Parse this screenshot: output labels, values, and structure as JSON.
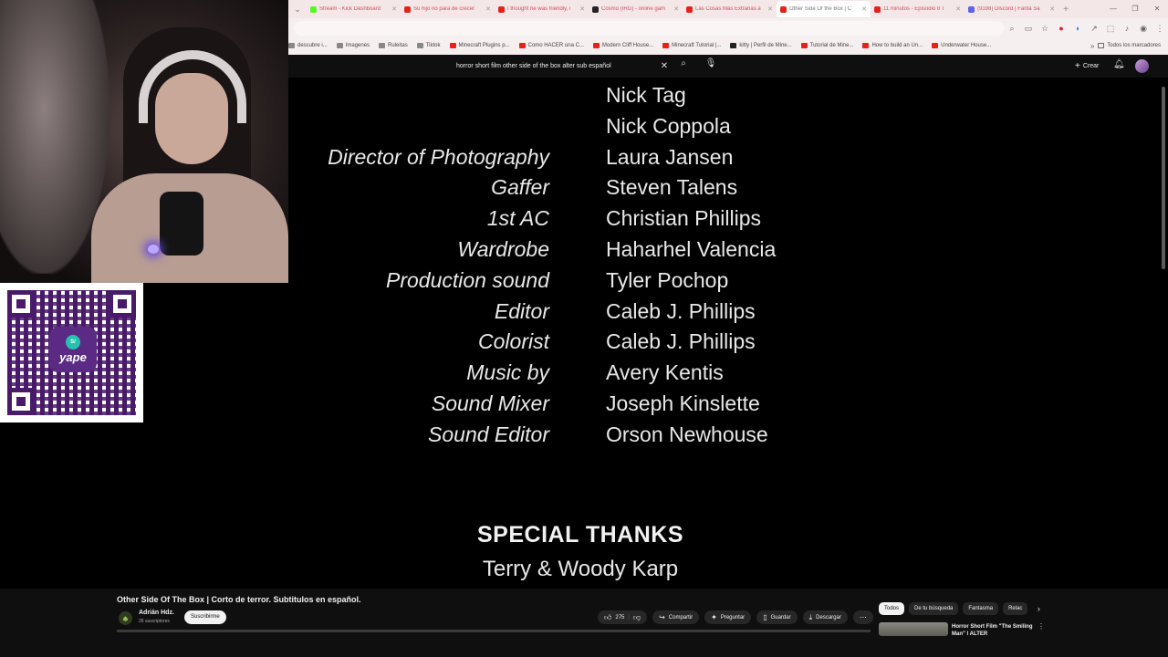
{
  "browser": {
    "tabs": [
      {
        "label": "Stream - Kick Dashboard",
        "color": "#53fc18",
        "active": false
      },
      {
        "label": "Su hijo no para de crecer",
        "color": "#e62117",
        "active": false
      },
      {
        "label": "I thought he was friendly, i",
        "color": "#e62117",
        "active": false
      },
      {
        "label": "Cosmo (IRG) - online gam",
        "color": "#222222",
        "active": false
      },
      {
        "label": "Las Cosas Más Extrañas a",
        "color": "#e62117",
        "active": false
      },
      {
        "label": "Other Side Of the Box | C",
        "color": "#e62117",
        "active": true
      },
      {
        "label": "11 minutos - Episodio 8 T",
        "color": "#e62117",
        "active": false
      },
      {
        "label": "(9198) Discord | Fanta Sa",
        "color": "#5865f2",
        "active": false
      }
    ],
    "bookmarks": [
      {
        "label": "descubre i...",
        "color": "#888888"
      },
      {
        "label": "Imagenes",
        "color": "#888888"
      },
      {
        "label": "Ruleitas",
        "color": "#888888"
      },
      {
        "label": "Tiktok",
        "color": "#888888"
      },
      {
        "label": "Minecraft Plugins p...",
        "color": "#e62117"
      },
      {
        "label": "Como HACER una C...",
        "color": "#e62117"
      },
      {
        "label": "Modern Cliff House...",
        "color": "#e62117"
      },
      {
        "label": "Minecraft Tutorial |...",
        "color": "#e62117"
      },
      {
        "label": "kitty | Perfil de Mine...",
        "color": "#222222"
      },
      {
        "label": "Tutorial de Mine...",
        "color": "#e62117"
      },
      {
        "label": "How to build an Un...",
        "color": "#e62117"
      },
      {
        "label": "Underwater House...",
        "color": "#e62117"
      }
    ],
    "all_bookmarks_label": "Todos los marcadores"
  },
  "header": {
    "search_query": "horror short film other side of the box alter sub español",
    "create_label": "Crear"
  },
  "credits": [
    {
      "role": "",
      "name": "Nick Tag"
    },
    {
      "role": "",
      "name": "Nick Coppola"
    },
    {
      "role": "Director of Photography",
      "name": "Laura Jansen"
    },
    {
      "role": "Gaffer",
      "name": "Steven Talens"
    },
    {
      "role": "1st AC",
      "name": "Christian Phillips"
    },
    {
      "role": "Wardrobe",
      "name": "Haharhel Valencia"
    },
    {
      "role": "Production sound",
      "name": "Tyler Pochop"
    },
    {
      "role": "Editor",
      "name": "Caleb J. Phillips"
    },
    {
      "role": "Colorist",
      "name": "Caleb J. Phillips"
    },
    {
      "role": "Music by",
      "name": "Avery Kentis"
    },
    {
      "role": "Sound Mixer",
      "name": "Joseph Kinslette"
    },
    {
      "role": "Sound Editor",
      "name": "Orson Newhouse"
    }
  ],
  "special_thanks": {
    "heading": "SPECIAL THANKS",
    "names": "Terry & Woody Karp"
  },
  "video": {
    "title": "Other Side Of The Box | Corto de terror. Subtitulos en español.",
    "channel": "Adrián Hdz.",
    "subscribers": "26 suscriptores",
    "subscribe_label": "Suscribirme",
    "likes": "275",
    "share_label": "Compartir",
    "ask_label": "Preguntar",
    "save_label": "Guardar",
    "download_label": "Descargar"
  },
  "chips": [
    {
      "label": "Todos",
      "active": true
    },
    {
      "label": "De tu búsqueda",
      "active": false
    },
    {
      "label": "Fantasma",
      "active": false
    },
    {
      "label": "Relac",
      "active": false
    }
  ],
  "recommendation": {
    "title": "Horror Short Film \"The Smiling Man\" | ALTER"
  },
  "qr": {
    "logo_coin": "S/",
    "logo_text": "yape"
  }
}
